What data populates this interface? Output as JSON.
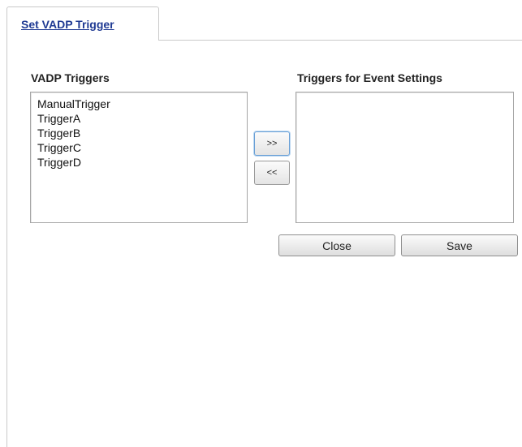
{
  "tab": {
    "label": "Set VADP Trigger"
  },
  "vadp_triggers": {
    "title": "VADP Triggers",
    "items": [
      "ManualTrigger",
      "TriggerA",
      "TriggerB",
      "TriggerC",
      "TriggerD"
    ]
  },
  "event_triggers": {
    "title": "Triggers for Event Settings",
    "items": []
  },
  "buttons": {
    "add_label": ">>",
    "remove_label": "<<",
    "close_label": "Close",
    "save_label": "Save"
  },
  "colors": {
    "tab_link": "#1f3a93",
    "border": "#c9c9c9"
  }
}
